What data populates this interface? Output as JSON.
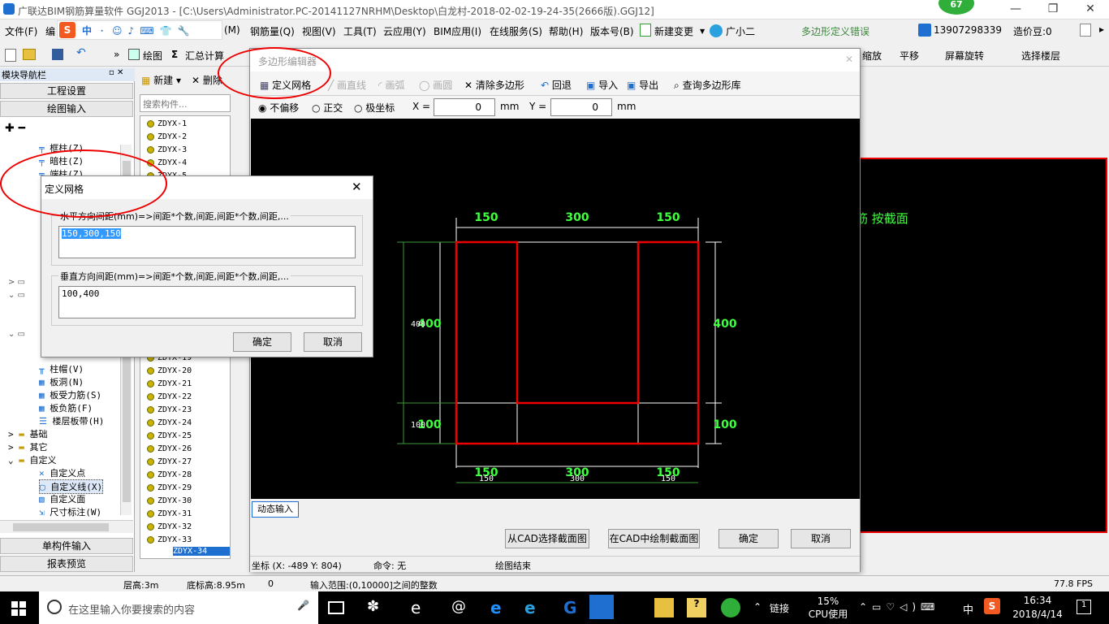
{
  "window": {
    "title": "广联达BIM钢筋算量软件 GGJ2013 - [C:\\Users\\Administrator.PC-20141127NRHM\\Desktop\\白龙村-2018-02-02-19-24-35(2666版).GGJ12]",
    "badge": "67",
    "controls": [
      "—",
      "❐",
      "✕"
    ]
  },
  "menu": {
    "items": [
      "文件(F)",
      "编",
      "(M)",
      "钢筋量(Q)",
      "视图(V)",
      "工具(T)",
      "云应用(Y)",
      "BIM应用(I)",
      "在线服务(S)",
      "帮助(H)",
      "版本号(B)",
      "新建变更",
      "广小二",
      "多边形定义错误"
    ],
    "phone": "13907298339",
    "price": "造价豆:0"
  },
  "toolbar": {
    "items": [
      "绘图",
      "汇总计算",
      "缩放",
      "平移",
      "屏幕旋转",
      "选择楼层"
    ]
  },
  "left_panel": {
    "title": "模块导航栏",
    "pin": "▫ ✕",
    "sections": [
      "工程设置",
      "绘图输入"
    ],
    "tree": [
      "框柱(Z)",
      "暗柱(Z)",
      "端柱(Z)",
      "柱帽(V)",
      "板洞(N)",
      "板受力筋(S)",
      "板负筋(F)",
      "楼层板带(H)",
      "基础",
      "其它",
      "自定义",
      "自定义点",
      "自定义线(X)",
      "自定义面",
      "尺寸标注(W)"
    ],
    "bottom": [
      "单构件输入",
      "报表预览"
    ]
  },
  "component_list": {
    "toolbar": [
      "新建",
      "删除"
    ],
    "search_placeholder": "搜索构件...",
    "items_top": [
      "ZDYX-1",
      "ZDYX-2",
      "ZDYX-3",
      "ZDYX-4",
      "ZDYX-5"
    ],
    "items_bottom": [
      "ZDYX-19",
      "ZDYX-20",
      "ZDYX-21",
      "ZDYX-22",
      "ZDYX-23",
      "ZDYX-24",
      "ZDYX-25",
      "ZDYX-26",
      "ZDYX-27",
      "ZDYX-28",
      "ZDYX-29",
      "ZDYX-30",
      "ZDYX-31",
      "ZDYX-32",
      "ZDYX-33",
      "ZDYX-34"
    ],
    "selected": "ZDYX-34"
  },
  "right_area": {
    "text1": "筋",
    "text2": "按截面"
  },
  "polygon_editor": {
    "title": "多边形编辑器",
    "toolbar": [
      "定义网格",
      "画直线",
      "画弧",
      "画圆",
      "清除多边形",
      "回退",
      "导入",
      "导出",
      "查询多边形库"
    ],
    "offset_options": [
      "不偏移",
      "正交",
      "极坐标"
    ],
    "x_label": "X =",
    "x_value": "0",
    "y_label": "Y =",
    "y_value": "0",
    "unit": "mm",
    "dynamic_input": "动态输入",
    "buttons": [
      "从CAD选择截面图",
      "在CAD中绘制截面图",
      "确定",
      "取消"
    ],
    "coords": "坐标 (X: -489 Y: 804)",
    "command": "命令: 无",
    "status": "绘图结束"
  },
  "canvas_dims": {
    "top": [
      "150",
      "300",
      "150"
    ],
    "bottom": [
      "150",
      "300",
      "150"
    ],
    "bottom_small": [
      "150",
      "300",
      "150"
    ],
    "left": [
      "400",
      "100"
    ],
    "left_small": [
      "400",
      "100"
    ],
    "right": [
      "400",
      "100"
    ]
  },
  "grid_dialog": {
    "title": "定义网格",
    "h_label": "水平方向间距(mm)=>间距*个数,间距,间距*个数,间距,...",
    "h_value": "150,300,150",
    "v_label": "垂直方向间距(mm)=>间距*个数,间距,间距*个数,间距,...",
    "v_value": "100,400",
    "ok": "确定",
    "cancel": "取消"
  },
  "statusbar": {
    "floor_height": "层高:3m",
    "base_height": "底标高:8.95m",
    "zero": "0",
    "input_range": "输入范围:(0,10000]之间的整数",
    "fps": "77.8 FPS"
  },
  "taskbar": {
    "search": "在这里输入你要搜索的内容",
    "link": "链接",
    "cpu_pct": "15%",
    "cpu_label": "CPU使用",
    "ime": "中",
    "time": "16:34",
    "date": "2018/4/14",
    "notif": "1"
  },
  "colors": {
    "accent_red": "#e00000",
    "dim_green": "#40ff40",
    "canvas": "#000000"
  }
}
